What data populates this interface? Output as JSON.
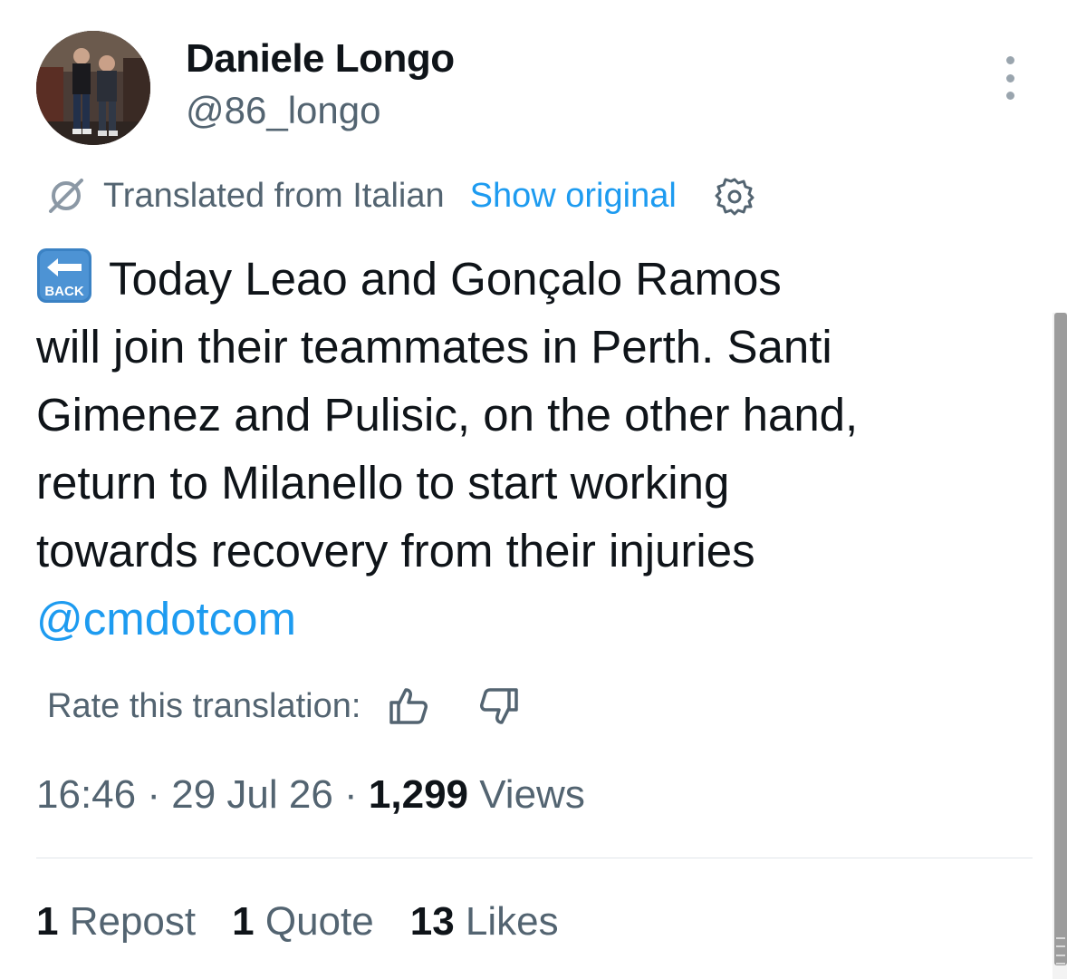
{
  "author": {
    "display_name": "Daniele Longo",
    "handle": "@86_longo"
  },
  "translation": {
    "notice": "Translated from Italian",
    "show_original": "Show original"
  },
  "tweet": {
    "emoji": "BACK",
    "lines": [
      "Today Leao and Gonçalo Ramos",
      "will join their teammates in Perth. Santi",
      "Gimenez and Pulisic, on the other hand,",
      "return to Milanello to start working",
      "towards recovery from their injuries"
    ],
    "mention": "@cmdotcom"
  },
  "rating": {
    "label": "Rate this translation:"
  },
  "meta": {
    "time": "16:46",
    "sep1": " · ",
    "date": "29 Jul 26",
    "sep2": " · ",
    "views_count": "1,299",
    "views_label": " Views"
  },
  "stats": [
    {
      "count": "1",
      "label": "Repost"
    },
    {
      "count": "1",
      "label": "Quote"
    },
    {
      "count": "13",
      "label": "Likes"
    }
  ],
  "colors": {
    "link": "#1d9bf0",
    "secondary_text": "#536471",
    "primary_text": "#0f1419",
    "emoji_blue": "#3b82c4"
  },
  "icons": {
    "more": "more-vertical-icon",
    "translate": "translate-icon",
    "settings": "gear-icon",
    "thumb_up": "thumb-up-icon",
    "thumb_down": "thumb-down-icon"
  }
}
